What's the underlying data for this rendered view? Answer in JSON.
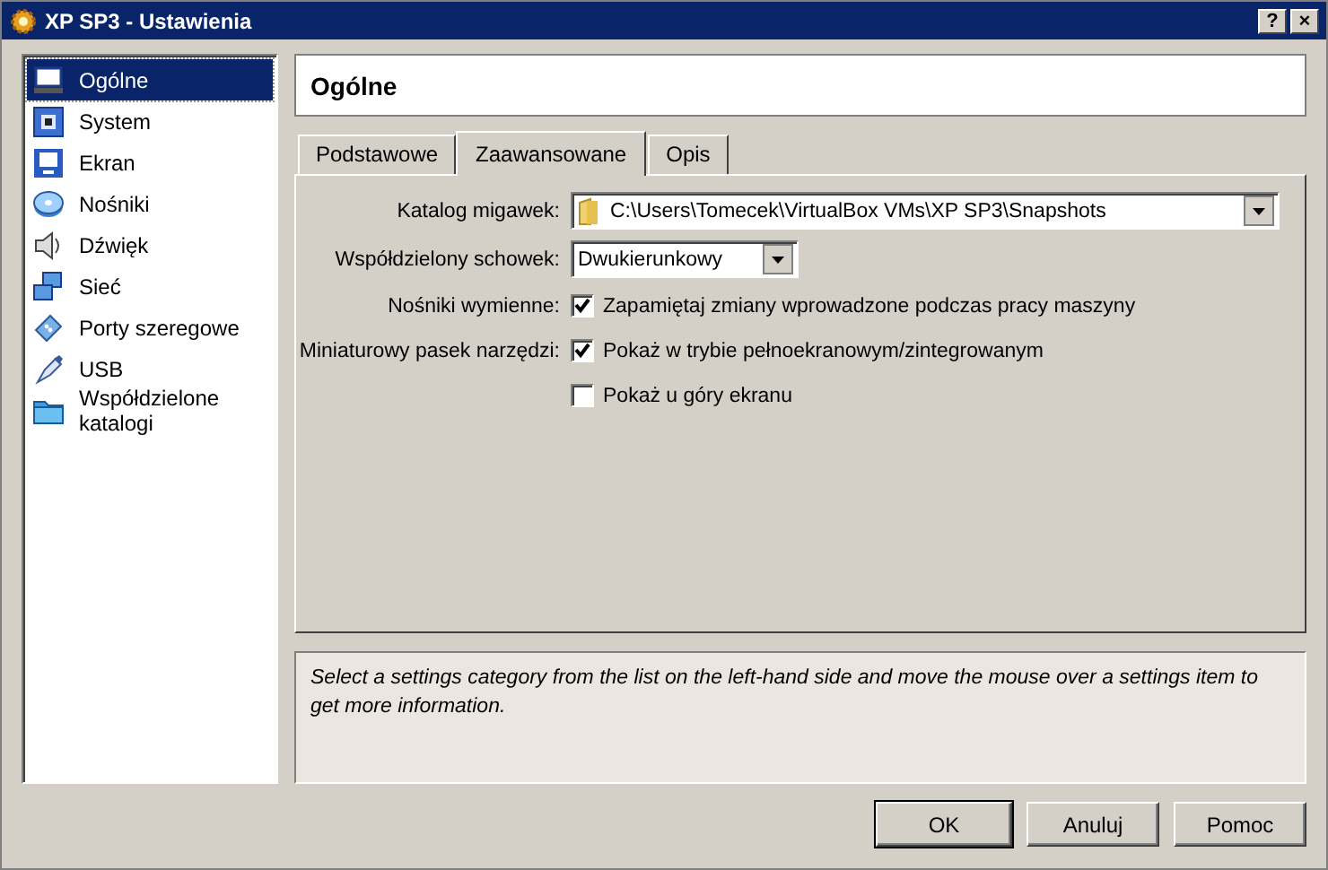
{
  "window": {
    "title": "XP SP3 - Ustawienia",
    "title_buttons": [
      "?",
      "×"
    ]
  },
  "sidebar": {
    "items": [
      {
        "label": "Ogólne",
        "selected": true
      },
      {
        "label": "System",
        "selected": false
      },
      {
        "label": "Ekran",
        "selected": false
      },
      {
        "label": "Nośniki",
        "selected": false
      },
      {
        "label": "Dźwięk",
        "selected": false
      },
      {
        "label": "Sieć",
        "selected": false
      },
      {
        "label": "Porty szeregowe",
        "selected": false
      },
      {
        "label": "USB",
        "selected": false
      },
      {
        "label": "Współdzielone katalogi",
        "selected": false
      }
    ]
  },
  "page_title": "Ogólne",
  "tabs": [
    {
      "label": "Podstawowe",
      "selected": false
    },
    {
      "label": "Zaawansowane",
      "selected": true
    },
    {
      "label": "Opis",
      "selected": false
    }
  ],
  "settings": [
    {
      "kind": "path",
      "label": "Katalog migawek:",
      "value": "C:\\Users\\Tomecek\\VirtualBox VMs\\XP SP3\\Snapshots"
    },
    {
      "kind": "combo",
      "label": "Współdzielony schowek:",
      "value": "Dwukierunkowy"
    },
    {
      "kind": "checkbox",
      "label": "Nośniki wymienne:",
      "text": "Zapamiętaj zmiany wprowadzone podczas pracy maszyny",
      "checked": true
    },
    {
      "kind": "checkbox",
      "label": "Miniaturowy pasek narzędzi:",
      "text": "Pokaż w trybie pełnoekranowym/zintegrowanym",
      "checked": true
    },
    {
      "kind": "checkbox",
      "text": "Pokaż u góry ekranu",
      "checked": false
    }
  ],
  "info": "Select a settings category from the list on the left-hand side and move the mouse over a settings item to get more information.",
  "buttons": [
    "OK",
    "Anuluj",
    "Pomoc"
  ]
}
